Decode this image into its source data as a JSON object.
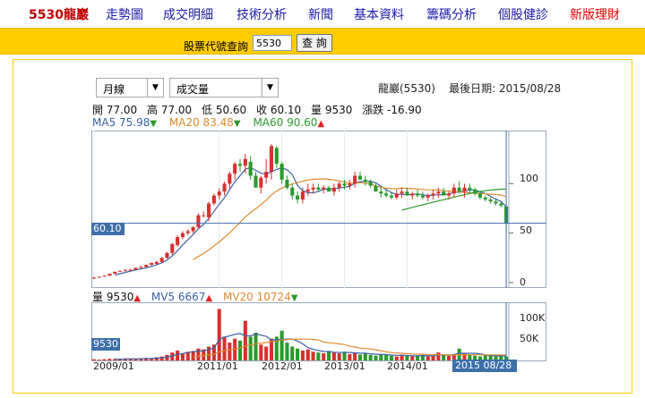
{
  "nav": {
    "code": "5530龍巖",
    "items": [
      "走勢圖",
      "成交明細",
      "技術分析",
      "新聞",
      "基本資料",
      "籌碼分析",
      "個股健診",
      "新版理財"
    ]
  },
  "search": {
    "label": "股票代號查詢",
    "value": "5530",
    "button": "查 詢"
  },
  "controls": {
    "period": "月線",
    "indicator": "成交量",
    "arrow": "▼"
  },
  "stock": {
    "name": "龍巖(5530)",
    "last_date_label": "最後日期: 2015/08/28"
  },
  "ohlc": {
    "open": "開 77.00",
    "high": "高 77.00",
    "low": "低 50.60",
    "close": "收 60.10",
    "volume": "量 9530",
    "change": "漲跌 -16.90"
  },
  "ma": {
    "ma5": "MA5 75.98",
    "ma20": "MA20 83.48",
    "ma60": "MA60 90.60",
    "ma5_color": "#3a62a8",
    "ma20_color": "#e08a30",
    "ma60_color": "#2a9a2a"
  },
  "vol_legend": {
    "vol": "量 9530",
    "mv5": "MV5 6667",
    "mv20": "MV20 10724"
  },
  "tri": {
    "up": "▲",
    "down": "▼"
  },
  "price_marker": "60.10",
  "vol_marker": "9530",
  "date_marker": "2015 08/28",
  "colors": {
    "up": "#d83030",
    "down": "#2a9a2a",
    "accent": "#ffcc00",
    "marker": "#3e6fa8"
  },
  "chart_data": {
    "type": "candlestick",
    "y_ticks": [
      "100",
      "50",
      "0"
    ],
    "ylim": [
      0,
      150
    ],
    "vol_ticks": [
      "100K",
      "50K"
    ],
    "vol_ylim": [
      0,
      140
    ],
    "x_ticks": [
      "2009/01",
      "2011/01",
      "2012/01",
      "2013/01",
      "2014/01"
    ],
    "x_tick_months": [
      0,
      24,
      36,
      48,
      60
    ],
    "months": 80,
    "candles": [
      [
        4,
        4,
        5,
        6
      ],
      [
        5,
        5,
        6,
        6
      ],
      [
        6,
        6,
        7,
        7
      ],
      [
        7,
        7,
        9,
        9
      ],
      [
        9,
        9,
        11,
        11
      ],
      [
        11,
        11,
        12,
        12
      ],
      [
        12,
        11,
        13,
        13
      ],
      [
        12,
        12,
        13,
        14
      ],
      [
        13,
        13,
        15,
        15
      ],
      [
        15,
        14,
        16,
        17
      ],
      [
        16,
        15,
        18,
        18
      ],
      [
        18,
        17,
        20,
        20
      ],
      [
        19,
        18,
        21,
        22
      ],
      [
        21,
        20,
        25,
        26
      ],
      [
        25,
        24,
        30,
        31
      ],
      [
        30,
        28,
        39,
        40
      ],
      [
        38,
        36,
        46,
        48
      ],
      [
        46,
        44,
        50,
        52
      ],
      [
        50,
        48,
        52,
        54
      ],
      [
        52,
        50,
        56,
        57
      ],
      [
        56,
        54,
        68,
        70
      ],
      [
        68,
        66,
        68,
        72
      ],
      [
        66,
        62,
        80,
        82
      ],
      [
        80,
        78,
        88,
        90
      ],
      [
        88,
        84,
        92,
        95
      ],
      [
        92,
        88,
        100,
        102
      ],
      [
        100,
        95,
        110,
        112
      ],
      [
        110,
        104,
        120,
        122
      ],
      [
        120,
        112,
        118,
        125
      ],
      [
        118,
        110,
        125,
        130
      ],
      [
        122,
        104,
        108,
        128
      ],
      [
        108,
        96,
        96,
        112
      ],
      [
        96,
        90,
        106,
        108
      ],
      [
        106,
        100,
        112,
        125
      ],
      [
        112,
        104,
        138,
        140
      ],
      [
        136,
        116,
        120,
        138
      ],
      [
        120,
        100,
        104,
        122
      ],
      [
        104,
        94,
        96,
        108
      ],
      [
        96,
        84,
        88,
        100
      ],
      [
        88,
        80,
        84,
        92
      ],
      [
        84,
        80,
        92,
        96
      ],
      [
        92,
        88,
        94,
        100
      ],
      [
        94,
        90,
        96,
        100
      ],
      [
        96,
        92,
        94,
        100
      ],
      [
        94,
        90,
        96,
        98
      ],
      [
        96,
        92,
        92,
        98
      ],
      [
        92,
        88,
        96,
        100
      ],
      [
        96,
        92,
        100,
        102
      ],
      [
        100,
        94,
        98,
        104
      ],
      [
        98,
        94,
        100,
        104
      ],
      [
        100,
        96,
        108,
        112
      ],
      [
        108,
        104,
        104,
        112
      ],
      [
        104,
        98,
        102,
        108
      ],
      [
        102,
        96,
        98,
        104
      ],
      [
        98,
        92,
        92,
        100
      ],
      [
        92,
        86,
        90,
        96
      ],
      [
        90,
        86,
        88,
        94
      ],
      [
        88,
        84,
        86,
        92
      ],
      [
        86,
        84,
        90,
        94
      ],
      [
        90,
        86,
        92,
        96
      ],
      [
        92,
        88,
        88,
        96
      ],
      [
        88,
        84,
        90,
        92
      ],
      [
        90,
        86,
        88,
        94
      ],
      [
        88,
        84,
        86,
        92
      ],
      [
        86,
        82,
        88,
        90
      ],
      [
        88,
        84,
        90,
        94
      ],
      [
        90,
        86,
        92,
        96
      ],
      [
        92,
        88,
        88,
        96
      ],
      [
        88,
        84,
        90,
        92
      ],
      [
        90,
        86,
        96,
        100
      ],
      [
        96,
        90,
        92,
        102
      ],
      [
        92,
        86,
        96,
        100
      ],
      [
        96,
        90,
        94,
        100
      ],
      [
        94,
        88,
        90,
        96
      ],
      [
        90,
        84,
        86,
        92
      ],
      [
        86,
        82,
        84,
        88
      ],
      [
        84,
        80,
        82,
        86
      ],
      [
        82,
        78,
        80,
        84
      ],
      [
        80,
        76,
        78,
        82
      ],
      [
        77,
        51,
        60,
        77
      ]
    ],
    "volume": [
      3,
      2,
      3,
      4,
      4,
      3,
      5,
      4,
      4,
      5,
      6,
      5,
      8,
      10,
      14,
      20,
      25,
      18,
      22,
      24,
      30,
      28,
      35,
      40,
      130,
      60,
      45,
      55,
      50,
      100,
      60,
      70,
      40,
      35,
      55,
      60,
      75,
      45,
      35,
      30,
      25,
      28,
      22,
      20,
      18,
      24,
      20,
      18,
      22,
      16,
      20,
      15,
      18,
      14,
      12,
      16,
      14,
      12,
      10,
      14,
      12,
      10,
      12,
      14,
      10,
      12,
      20,
      14,
      12,
      16,
      30,
      18,
      14,
      12,
      10,
      14,
      12,
      10,
      12,
      10
    ]
  }
}
